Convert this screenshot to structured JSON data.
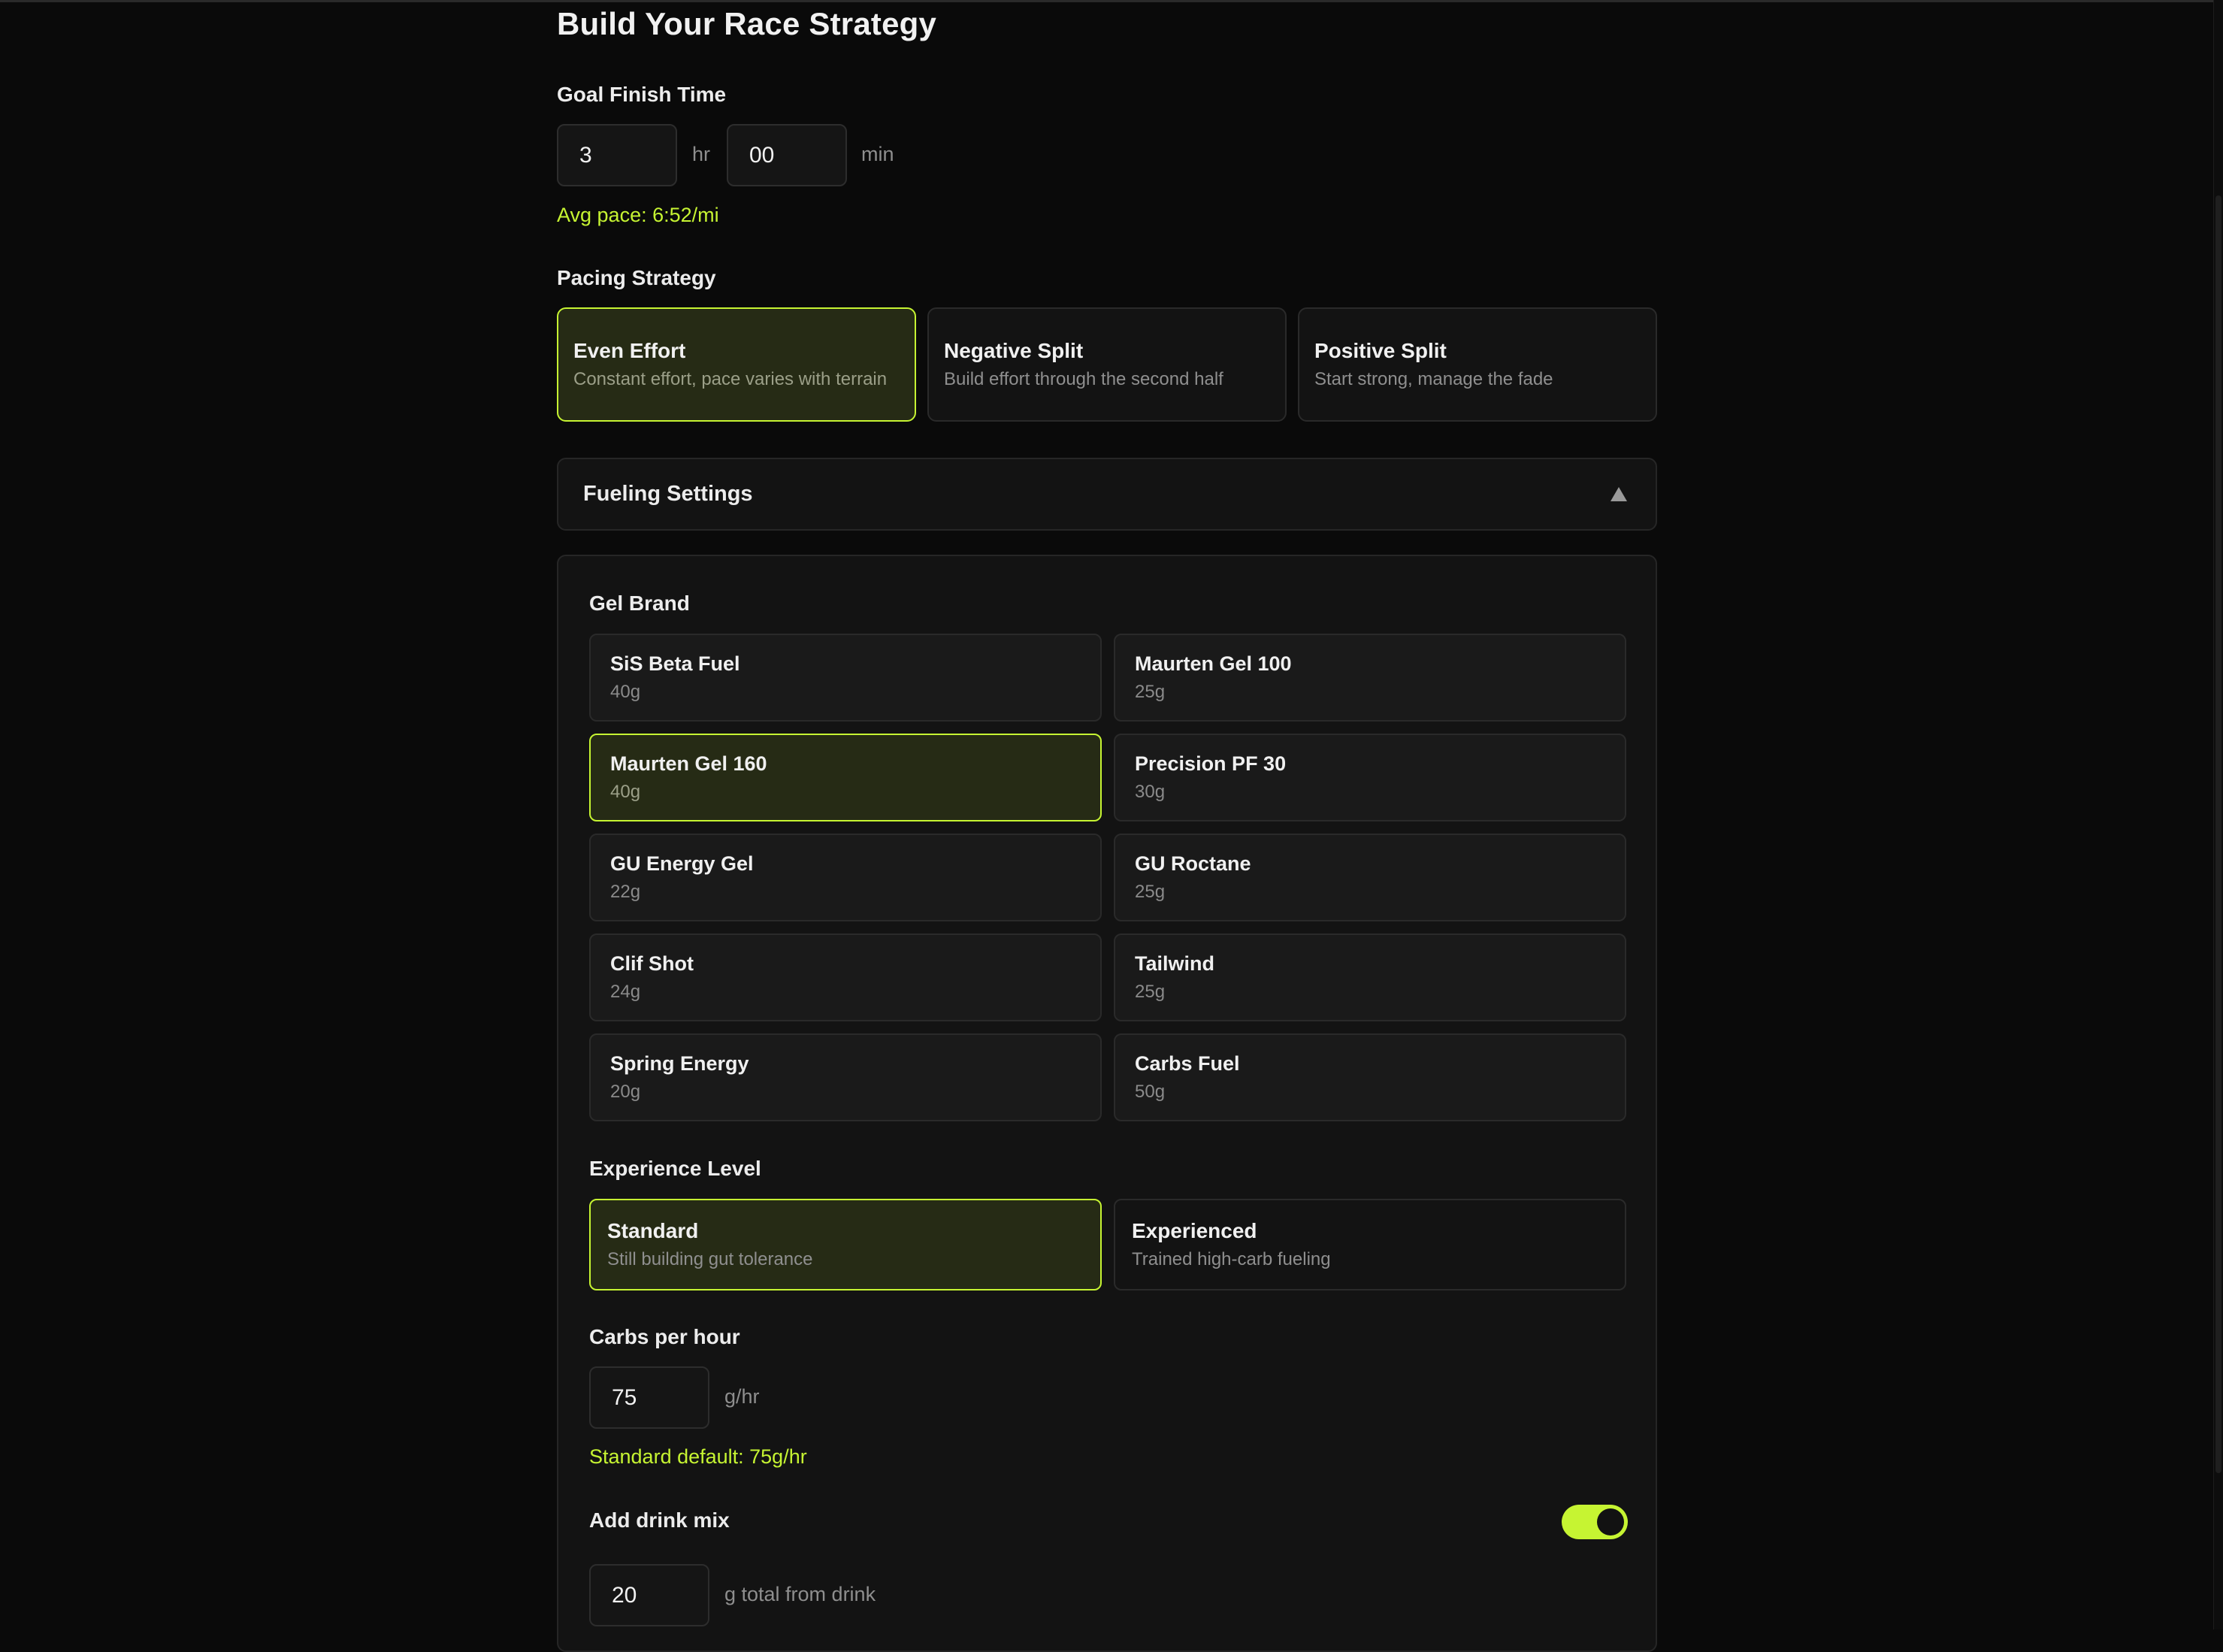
{
  "page": {
    "title": "Build Your Race Strategy"
  },
  "goal": {
    "label": "Goal Finish Time",
    "hours": "3",
    "hours_unit": "hr",
    "minutes": "00",
    "minutes_unit": "min",
    "avg_pace": "Avg pace: 6:52/mi"
  },
  "pacing": {
    "label": "Pacing Strategy",
    "options": [
      {
        "title": "Even Effort",
        "subtitle": "Constant effort, pace varies with terrain",
        "selected": true
      },
      {
        "title": "Negative Split",
        "subtitle": "Build effort through the second half",
        "selected": false
      },
      {
        "title": "Positive Split",
        "subtitle": "Start strong, manage the fade",
        "selected": false
      }
    ]
  },
  "fueling": {
    "header": "Fueling Settings",
    "gel_label": "Gel Brand",
    "gels": [
      {
        "name": "SiS Beta Fuel",
        "weight": "40g",
        "selected": false
      },
      {
        "name": "Maurten Gel 100",
        "weight": "25g",
        "selected": false
      },
      {
        "name": "Maurten Gel 160",
        "weight": "40g",
        "selected": true
      },
      {
        "name": "Precision PF 30",
        "weight": "30g",
        "selected": false
      },
      {
        "name": "GU Energy Gel",
        "weight": "22g",
        "selected": false
      },
      {
        "name": "GU Roctane",
        "weight": "25g",
        "selected": false
      },
      {
        "name": "Clif Shot",
        "weight": "24g",
        "selected": false
      },
      {
        "name": "Tailwind",
        "weight": "25g",
        "selected": false
      },
      {
        "name": "Spring Energy",
        "weight": "20g",
        "selected": false
      },
      {
        "name": "Carbs Fuel",
        "weight": "50g",
        "selected": false
      }
    ],
    "experience_label": "Experience Level",
    "experience": [
      {
        "title": "Standard",
        "subtitle": "Still building gut tolerance",
        "selected": true
      },
      {
        "title": "Experienced",
        "subtitle": "Trained high-carb fueling",
        "selected": false
      }
    ],
    "carbs_label": "Carbs per hour",
    "carbs_value": "75",
    "carbs_unit": "g/hr",
    "carbs_default": "Standard default: 75g/hr",
    "drink_label": "Add drink mix",
    "drink_enabled": true,
    "drink_value": "20",
    "drink_unit": "g total from drink"
  },
  "colors": {
    "accent": "#c6f432",
    "background": "#0a0a0a",
    "card": "#131313",
    "selected_card": "#262b15"
  }
}
